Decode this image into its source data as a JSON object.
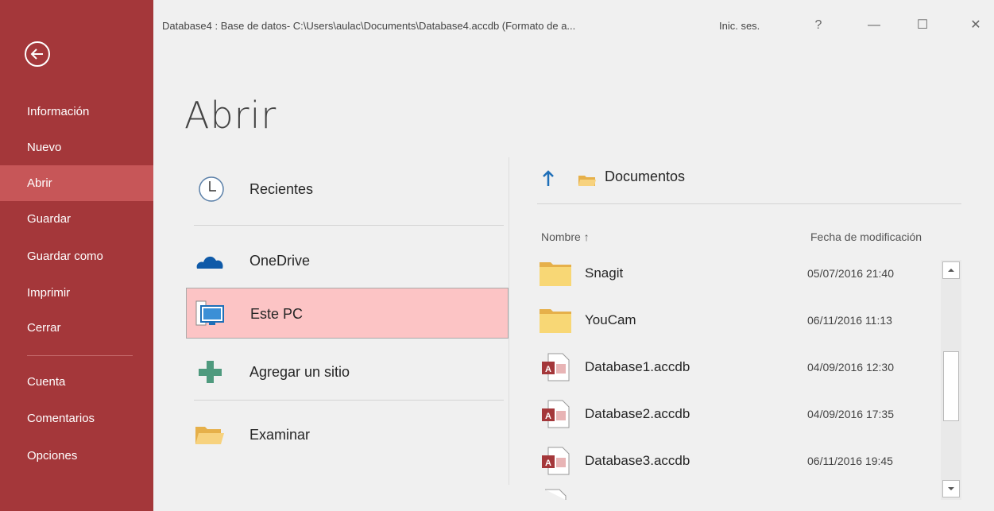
{
  "window": {
    "title": "Database4 : Base de datos- C:\\Users\\aulac\\Documents\\Database4.accdb (Formato de a...",
    "signin": "Inic. ses.",
    "help": "?",
    "minimize": "—",
    "maximize": "☐",
    "close": "✕"
  },
  "sidebar": {
    "accent": "#a4373a",
    "items": [
      {
        "label": "Información"
      },
      {
        "label": "Nuevo"
      },
      {
        "label": "Abrir",
        "active": true
      },
      {
        "label": "Guardar"
      },
      {
        "label": "Guardar como"
      },
      {
        "label": "Imprimir"
      },
      {
        "label": "Cerrar"
      },
      {
        "label": "Cuenta"
      },
      {
        "label": "Comentarios"
      },
      {
        "label": "Opciones"
      }
    ]
  },
  "main": {
    "title": "Abrir",
    "locations": [
      {
        "label": "Recientes",
        "icon": "clock-icon"
      },
      {
        "label": "OneDrive",
        "icon": "cloud-icon"
      },
      {
        "label": "Este PC",
        "icon": "computer-icon",
        "selected": true
      },
      {
        "label": "Agregar un sitio",
        "icon": "plus-icon"
      },
      {
        "label": "Examinar",
        "icon": "folder-open-icon"
      }
    ]
  },
  "browser": {
    "path": "Documentos",
    "columns": {
      "name": "Nombre ↑",
      "date": "Fecha de modificación"
    },
    "files": [
      {
        "name": "Snagit",
        "date": "05/07/2016 21:40",
        "type": "folder"
      },
      {
        "name": "YouCam",
        "date": "06/11/2016 11:13",
        "type": "folder"
      },
      {
        "name": "Database1.accdb",
        "date": "04/09/2016 12:30",
        "type": "access-file"
      },
      {
        "name": "Database2.accdb",
        "date": "04/09/2016 17:35",
        "type": "access-file"
      },
      {
        "name": "Database3.accdb",
        "date": "06/11/2016 19:45",
        "type": "access-file"
      }
    ]
  }
}
